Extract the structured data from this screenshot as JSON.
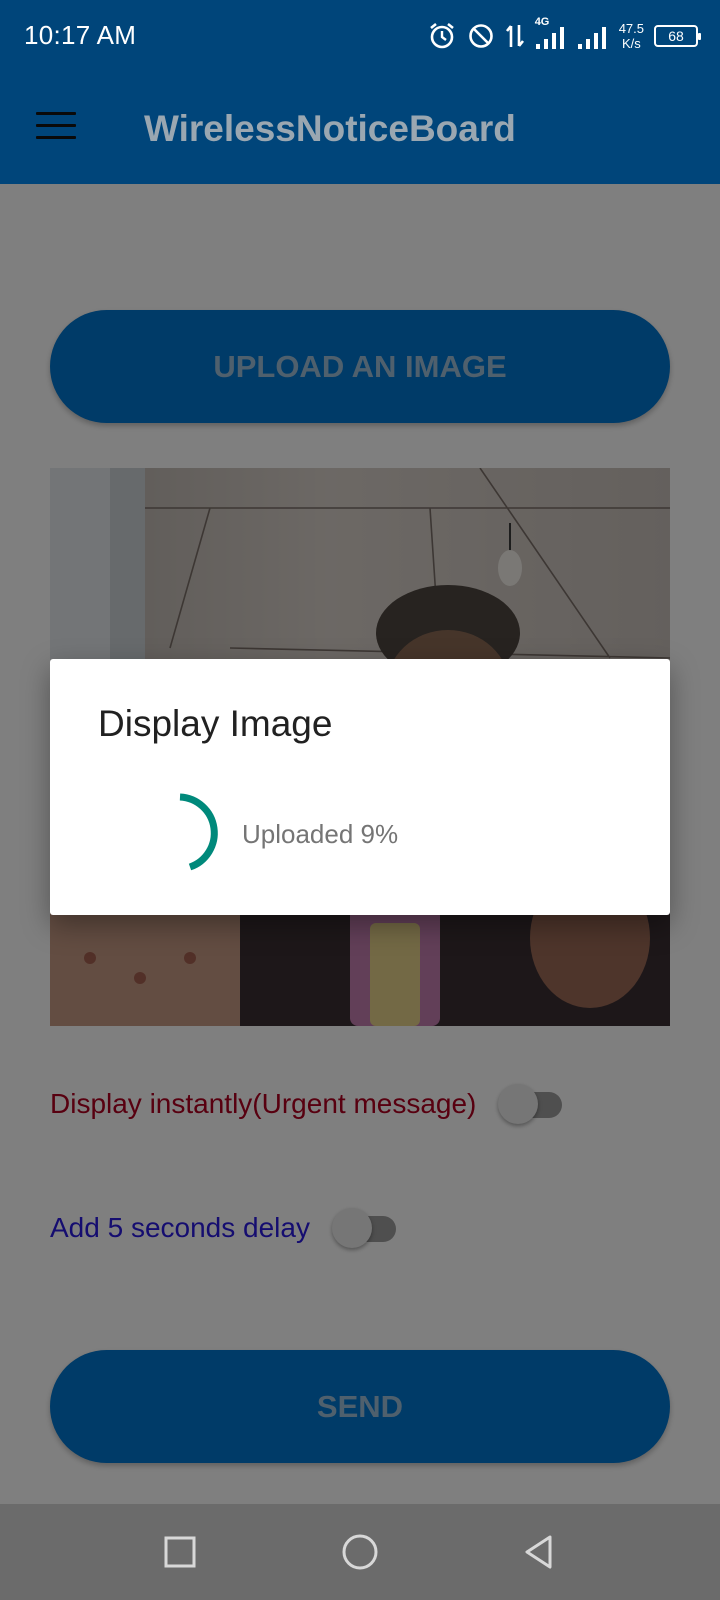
{
  "status_bar": {
    "time": "10:17 AM",
    "network_type": "4G",
    "net_speed_value": "47.5",
    "net_speed_unit": "K/s",
    "battery_level": "68",
    "icons": [
      "alarm-icon",
      "do-not-disturb-icon",
      "data-transfer-icon",
      "signal-icon",
      "signal-icon",
      "battery-icon"
    ]
  },
  "app_bar": {
    "title": "WirelessNoticeBoard",
    "menu_icon": "menu-icon"
  },
  "main": {
    "upload_button_label": "UPLOAD AN IMAGE",
    "photo_description": "selected image preview",
    "urgent_toggle": {
      "label": "Display instantly(Urgent message)",
      "checked": false
    },
    "delay_toggle": {
      "label": "Add 5 seconds delay",
      "checked": false
    },
    "send_button_label": "SEND"
  },
  "dialog": {
    "title": "Display Image",
    "message": "Uploaded 9%",
    "progress_percent": 9
  },
  "nav_bar": {
    "buttons": [
      "recents-icon",
      "home-icon",
      "back-icon"
    ]
  },
  "colors": {
    "primary_dark": "#00457a",
    "primary": "#0076d0",
    "accent_spinner": "#00897b",
    "urgent_label": "#b00020",
    "delay_label": "#2a1ae0"
  }
}
